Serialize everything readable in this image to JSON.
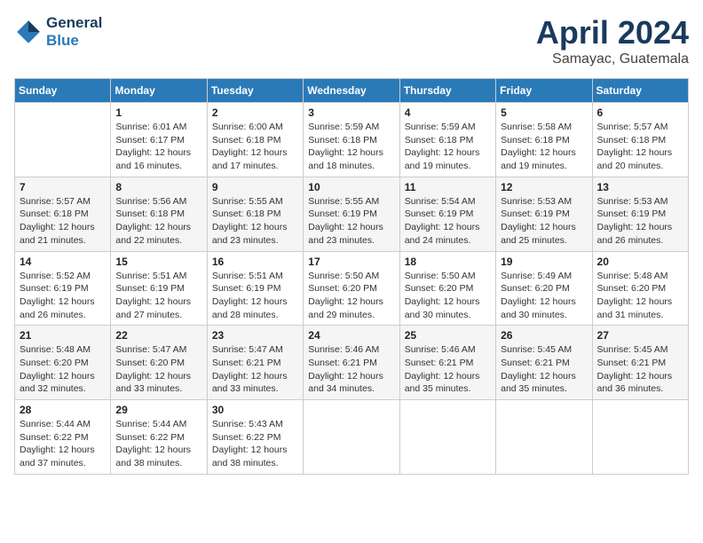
{
  "header": {
    "logo_line1": "General",
    "logo_line2": "Blue",
    "month_title": "April 2024",
    "location": "Samayac, Guatemala"
  },
  "weekdays": [
    "Sunday",
    "Monday",
    "Tuesday",
    "Wednesday",
    "Thursday",
    "Friday",
    "Saturday"
  ],
  "weeks": [
    [
      {
        "day": "",
        "info": ""
      },
      {
        "day": "1",
        "info": "Sunrise: 6:01 AM\nSunset: 6:17 PM\nDaylight: 12 hours\nand 16 minutes."
      },
      {
        "day": "2",
        "info": "Sunrise: 6:00 AM\nSunset: 6:18 PM\nDaylight: 12 hours\nand 17 minutes."
      },
      {
        "day": "3",
        "info": "Sunrise: 5:59 AM\nSunset: 6:18 PM\nDaylight: 12 hours\nand 18 minutes."
      },
      {
        "day": "4",
        "info": "Sunrise: 5:59 AM\nSunset: 6:18 PM\nDaylight: 12 hours\nand 19 minutes."
      },
      {
        "day": "5",
        "info": "Sunrise: 5:58 AM\nSunset: 6:18 PM\nDaylight: 12 hours\nand 19 minutes."
      },
      {
        "day": "6",
        "info": "Sunrise: 5:57 AM\nSunset: 6:18 PM\nDaylight: 12 hours\nand 20 minutes."
      }
    ],
    [
      {
        "day": "7",
        "info": "Sunrise: 5:57 AM\nSunset: 6:18 PM\nDaylight: 12 hours\nand 21 minutes."
      },
      {
        "day": "8",
        "info": "Sunrise: 5:56 AM\nSunset: 6:18 PM\nDaylight: 12 hours\nand 22 minutes."
      },
      {
        "day": "9",
        "info": "Sunrise: 5:55 AM\nSunset: 6:18 PM\nDaylight: 12 hours\nand 23 minutes."
      },
      {
        "day": "10",
        "info": "Sunrise: 5:55 AM\nSunset: 6:19 PM\nDaylight: 12 hours\nand 23 minutes."
      },
      {
        "day": "11",
        "info": "Sunrise: 5:54 AM\nSunset: 6:19 PM\nDaylight: 12 hours\nand 24 minutes."
      },
      {
        "day": "12",
        "info": "Sunrise: 5:53 AM\nSunset: 6:19 PM\nDaylight: 12 hours\nand 25 minutes."
      },
      {
        "day": "13",
        "info": "Sunrise: 5:53 AM\nSunset: 6:19 PM\nDaylight: 12 hours\nand 26 minutes."
      }
    ],
    [
      {
        "day": "14",
        "info": "Sunrise: 5:52 AM\nSunset: 6:19 PM\nDaylight: 12 hours\nand 26 minutes."
      },
      {
        "day": "15",
        "info": "Sunrise: 5:51 AM\nSunset: 6:19 PM\nDaylight: 12 hours\nand 27 minutes."
      },
      {
        "day": "16",
        "info": "Sunrise: 5:51 AM\nSunset: 6:19 PM\nDaylight: 12 hours\nand 28 minutes."
      },
      {
        "day": "17",
        "info": "Sunrise: 5:50 AM\nSunset: 6:20 PM\nDaylight: 12 hours\nand 29 minutes."
      },
      {
        "day": "18",
        "info": "Sunrise: 5:50 AM\nSunset: 6:20 PM\nDaylight: 12 hours\nand 30 minutes."
      },
      {
        "day": "19",
        "info": "Sunrise: 5:49 AM\nSunset: 6:20 PM\nDaylight: 12 hours\nand 30 minutes."
      },
      {
        "day": "20",
        "info": "Sunrise: 5:48 AM\nSunset: 6:20 PM\nDaylight: 12 hours\nand 31 minutes."
      }
    ],
    [
      {
        "day": "21",
        "info": "Sunrise: 5:48 AM\nSunset: 6:20 PM\nDaylight: 12 hours\nand 32 minutes."
      },
      {
        "day": "22",
        "info": "Sunrise: 5:47 AM\nSunset: 6:20 PM\nDaylight: 12 hours\nand 33 minutes."
      },
      {
        "day": "23",
        "info": "Sunrise: 5:47 AM\nSunset: 6:21 PM\nDaylight: 12 hours\nand 33 minutes."
      },
      {
        "day": "24",
        "info": "Sunrise: 5:46 AM\nSunset: 6:21 PM\nDaylight: 12 hours\nand 34 minutes."
      },
      {
        "day": "25",
        "info": "Sunrise: 5:46 AM\nSunset: 6:21 PM\nDaylight: 12 hours\nand 35 minutes."
      },
      {
        "day": "26",
        "info": "Sunrise: 5:45 AM\nSunset: 6:21 PM\nDaylight: 12 hours\nand 35 minutes."
      },
      {
        "day": "27",
        "info": "Sunrise: 5:45 AM\nSunset: 6:21 PM\nDaylight: 12 hours\nand 36 minutes."
      }
    ],
    [
      {
        "day": "28",
        "info": "Sunrise: 5:44 AM\nSunset: 6:22 PM\nDaylight: 12 hours\nand 37 minutes."
      },
      {
        "day": "29",
        "info": "Sunrise: 5:44 AM\nSunset: 6:22 PM\nDaylight: 12 hours\nand 38 minutes."
      },
      {
        "day": "30",
        "info": "Sunrise: 5:43 AM\nSunset: 6:22 PM\nDaylight: 12 hours\nand 38 minutes."
      },
      {
        "day": "",
        "info": ""
      },
      {
        "day": "",
        "info": ""
      },
      {
        "day": "",
        "info": ""
      },
      {
        "day": "",
        "info": ""
      }
    ]
  ]
}
